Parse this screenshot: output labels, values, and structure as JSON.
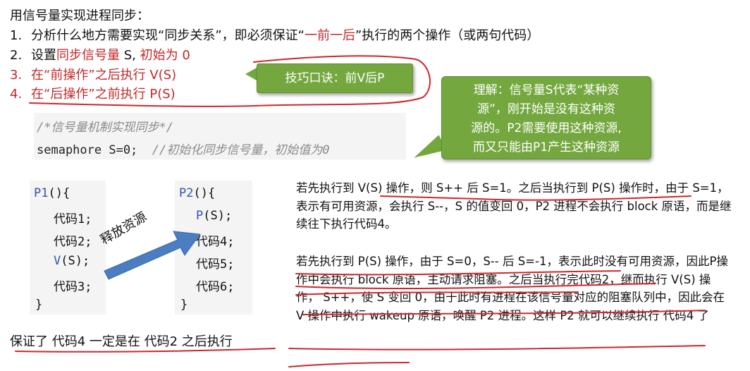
{
  "title": "用信号量实现进程同步：",
  "steps": [
    {
      "num": "1.",
      "pre": "分析什么地方需要实现“同步关系”，即必须保证“",
      "red": "一前一后",
      "post": "”执行的两个操作（或两句代码）"
    },
    {
      "num": "2.",
      "pre": "设置",
      "red": "同步信号量",
      "mid": " S, ",
      "red2": "初始为 0"
    },
    {
      "num": "3.",
      "text": "在“前操作”之后执行 V(S)"
    },
    {
      "num": "4.",
      "text": "在“后操作”之前执行 P(S)"
    }
  ],
  "tip_short": "技巧口诀：前V后P",
  "tip_long": [
    "理解：信号量S代表“某种资",
    "源”，刚开始是没有这种资",
    "源的。P2需要使用这种资源,",
    "而又只能由P1产生这种资源"
  ],
  "code_header": {
    "comment": "/*信号量机制实现同步*/",
    "decl": "semaphore S=0;",
    "decl_comment": "//初始化同步信号量，初始值为0"
  },
  "p1_code": {
    "head_kw": "P1",
    "head_rest": "(){",
    "lines": [
      "代码1;",
      "代码2;"
    ],
    "v_kw": "V",
    "v_rest": "(S);",
    "after": "代码3;",
    "close": "}"
  },
  "p2_code": {
    "head_kw": "P2",
    "head_rest": "(){",
    "p_kw": "P",
    "p_rest": "(S);",
    "lines": [
      "代码4;",
      "代码5;",
      "代码6;"
    ],
    "close": "}"
  },
  "arrow_label": "释放资源",
  "summary": "保证了 代码4 一定是在 代码2 之后执行",
  "para1": "若先执行到 V(S) 操作，则 S++ 后 S=1。之后当执行到 P(S) 操作时，由于 S=1，表示有可用资源，会执行 S--，S 的值变回 0，P2 进程不会执行 block 原语，而是继续往下执行代码4。",
  "para2": "若先执行到 P(S) 操作，由于 S=0，S-- 后 S=-1，表示此时没有可用资源，因此P操作中会执行 block 原语，主动请求阻塞。之后当执行完代码2，继而执行 V(S) 操作， S++，使 S 变回 0，由于此时有进程在该信号量对应的阻塞队列中，因此会在 V 操作中执行 wakeup 原语，唤醒 P2 进程。这样 P2 就可以继续执行 代码4 了",
  "colors": {
    "accent_red": "#c0282a",
    "tip_green": "#74a83f",
    "keyword_blue": "#2e59a8",
    "arrow_blue": "#4a7ec0"
  }
}
